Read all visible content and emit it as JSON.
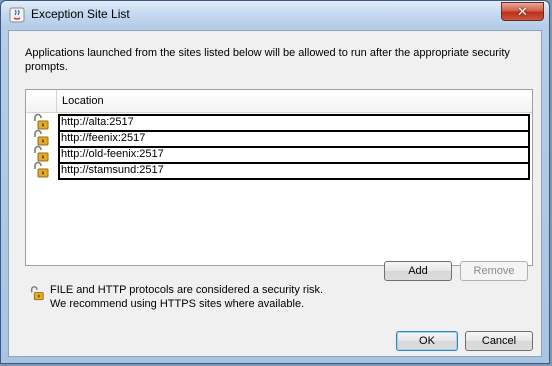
{
  "window": {
    "title": "Exception Site List",
    "close_label": "✕"
  },
  "description": "Applications launched from the sites listed below will be allowed to run after the appropriate security prompts.",
  "table": {
    "header": "Location",
    "rows": [
      {
        "url": "http://alta:2517",
        "icon": "open-padlock-icon"
      },
      {
        "url": "http://feenix:2517",
        "icon": "open-padlock-icon"
      },
      {
        "url": "http://old-feenix:2517",
        "icon": "open-padlock-icon"
      },
      {
        "url": "http://stamsund:2517",
        "icon": "open-padlock-icon"
      }
    ]
  },
  "buttons": {
    "add": "Add",
    "remove": "Remove",
    "ok": "OK",
    "cancel": "Cancel"
  },
  "security_note": {
    "line1": "FILE and HTTP protocols are considered a security risk.",
    "line2": "We recommend using HTTPS sites where available.",
    "icon": "open-padlock-icon"
  },
  "colors": {
    "padlock": "#d9a41e",
    "close_button": "#c8452e",
    "ok_border": "#3c7fb1"
  }
}
